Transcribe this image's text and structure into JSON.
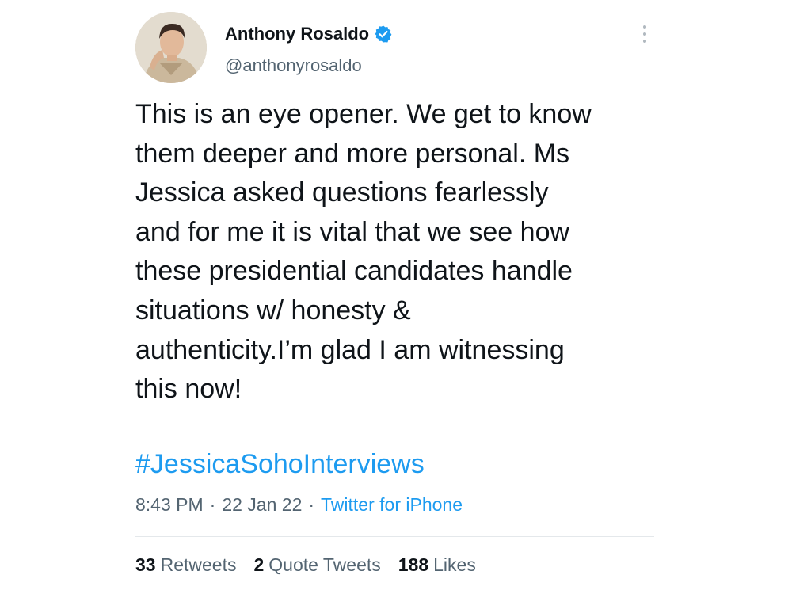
{
  "author": {
    "display_name": "Anthony Rosaldo",
    "handle": "@anthonyrosaldo",
    "verified_icon": "verified-badge-icon",
    "verified_color": "#1d9bf0"
  },
  "tweet": {
    "text": "This is an eye opener. We get to know\nthem deeper and more personal. Ms\nJessica asked questions fearlessly\nand for me it is vital that we see how\nthese presidential candidates handle\nsituations w/ honesty &\nauthenticity.I’m glad I am witnessing\nthis now!",
    "hashtag": "#JessicaSohoInterviews"
  },
  "meta": {
    "time": "8:43 PM",
    "separator": "·",
    "date": "22 Jan 22",
    "source": "Twitter for iPhone"
  },
  "stats": {
    "retweets_count": "33",
    "retweets_label": "Retweets",
    "quote_count": "2",
    "quote_label": "Quote Tweets",
    "likes_count": "188",
    "likes_label": "Likes"
  },
  "colors": {
    "link": "#1d9bf0",
    "text": "#0f1419",
    "secondary": "#536471"
  }
}
